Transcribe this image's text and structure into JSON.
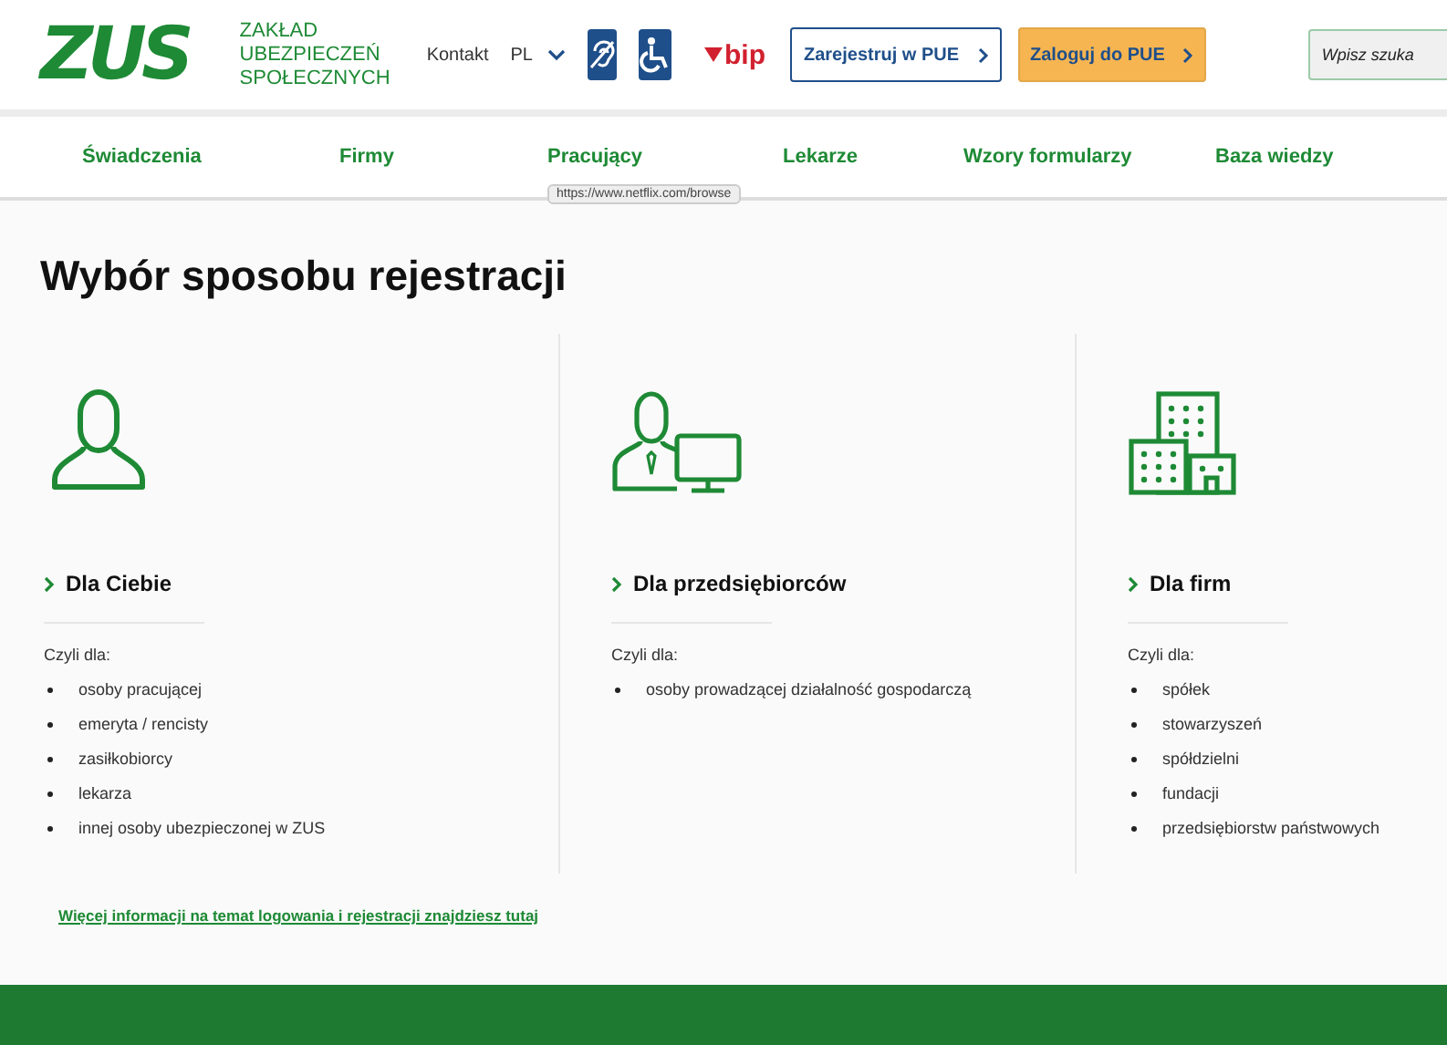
{
  "header": {
    "logo": "ZUS",
    "org_name": [
      "ZAKŁAD",
      "UBEZPIECZEŃ",
      "SPOŁECZNYCH"
    ],
    "contact": "Kontakt",
    "language": "PL",
    "bip": "bip",
    "register_button": "Zarejestruj w PUE",
    "login_button": "Zaloguj do PUE",
    "search": {
      "placeholder": "Wpisz szuka"
    }
  },
  "nav": [
    "Świadczenia",
    "Firmy",
    "Pracujący",
    "Lekarze",
    "Wzory formularzy",
    "Baza wiedzy"
  ],
  "tooltip": "https://www.netflix.com/browse",
  "title": "Wybór sposobu rejestracji",
  "options": [
    {
      "kind": "person",
      "heading": "Dla Ciebie",
      "intro": "Czyli dla:",
      "items": [
        "osoby pracującej",
        "emeryta / rencisty",
        "zasiłkobiorcy",
        "lekarza",
        "innej osoby ubezpieczonej w ZUS"
      ]
    },
    {
      "kind": "business",
      "heading": "Dla przedsiębiorców",
      "intro": "Czyli dla:",
      "items": [
        "osoby prowadzącej działalność gospodarczą"
      ]
    },
    {
      "kind": "company",
      "heading": "Dla firm",
      "intro": "Czyli dla:",
      "items": [
        "spółek",
        "stowarzyszeń",
        "spółdzielni",
        "fundacji",
        "przedsiębiorstw państwowych"
      ]
    }
  ],
  "more_link": "Więcej informacji na temat logowania i rejestracji znajdziesz tutaj"
}
